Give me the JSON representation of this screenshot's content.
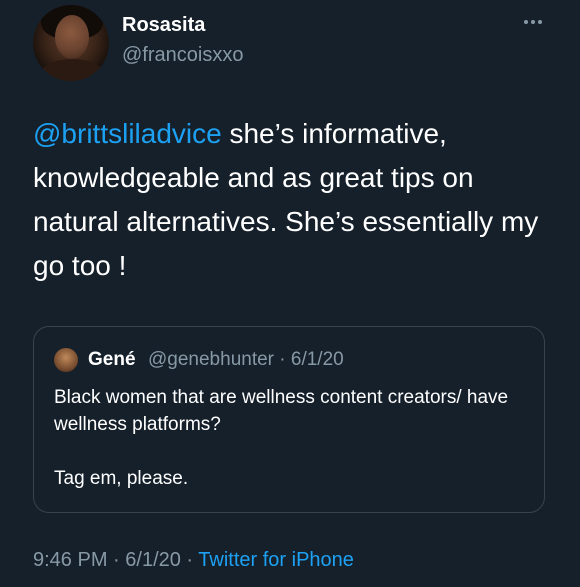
{
  "tweet": {
    "author_name": "Rosasita",
    "author_handle": "@francoisxxo",
    "mention": "@brittsliladvice",
    "text": " she’s informative, knowledgeable and as great tips on natural alternatives. She’s essentially my go too !",
    "time": "9:46 PM",
    "date": "6/1/20",
    "source": "Twitter for iPhone",
    "separator": " · "
  },
  "quoted_tweet": {
    "author_name": "Gené",
    "author_handle": "@genebhunter",
    "date": "6/1/20",
    "separator": " · ",
    "paragraphs": [
      "Black women that are wellness content creators/ have wellness platforms?",
      "Tag em, please."
    ]
  },
  "icons": {
    "more": "more-options-icon"
  },
  "colors": {
    "background": "#15202b",
    "link": "#1da1f2",
    "secondary_text": "#8899a6",
    "border": "#38444d"
  }
}
